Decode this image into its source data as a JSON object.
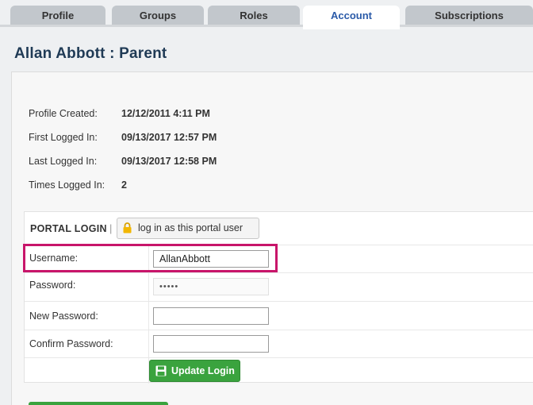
{
  "tabs": [
    {
      "label": "Profile",
      "active": false
    },
    {
      "label": "Groups",
      "active": false
    },
    {
      "label": "Roles",
      "active": false
    },
    {
      "label": "Account",
      "active": true
    },
    {
      "label": "Subscriptions",
      "active": false
    }
  ],
  "page_title": "Allan Abbott : Parent",
  "info": [
    {
      "label": "Profile Created:",
      "value": "12/12/2011 4:11 PM"
    },
    {
      "label": "First Logged In:",
      "value": "09/13/2017 12:57 PM"
    },
    {
      "label": "Last Logged In:",
      "value": "09/13/2017 12:58 PM"
    },
    {
      "label": "Times Logged In:",
      "value": "2"
    }
  ],
  "portal": {
    "title": "PORTAL LOGIN",
    "separator": "|",
    "login_as_label": "log in as this portal user",
    "username_label": "Username:",
    "username_value": "AllanAbbott",
    "password_label": "Password:",
    "password_value": "•••••",
    "new_password_label": "New Password:",
    "confirm_password_label": "Confirm Password:",
    "update_label": "Update Login"
  },
  "colors": {
    "accent_tab_text": "#2a5aa8",
    "title": "#1f3a55",
    "highlight": "#c8156a",
    "update_button": "#3aa33e"
  },
  "icons": {
    "lock": "lock-icon",
    "save": "floppy-disk-icon"
  }
}
